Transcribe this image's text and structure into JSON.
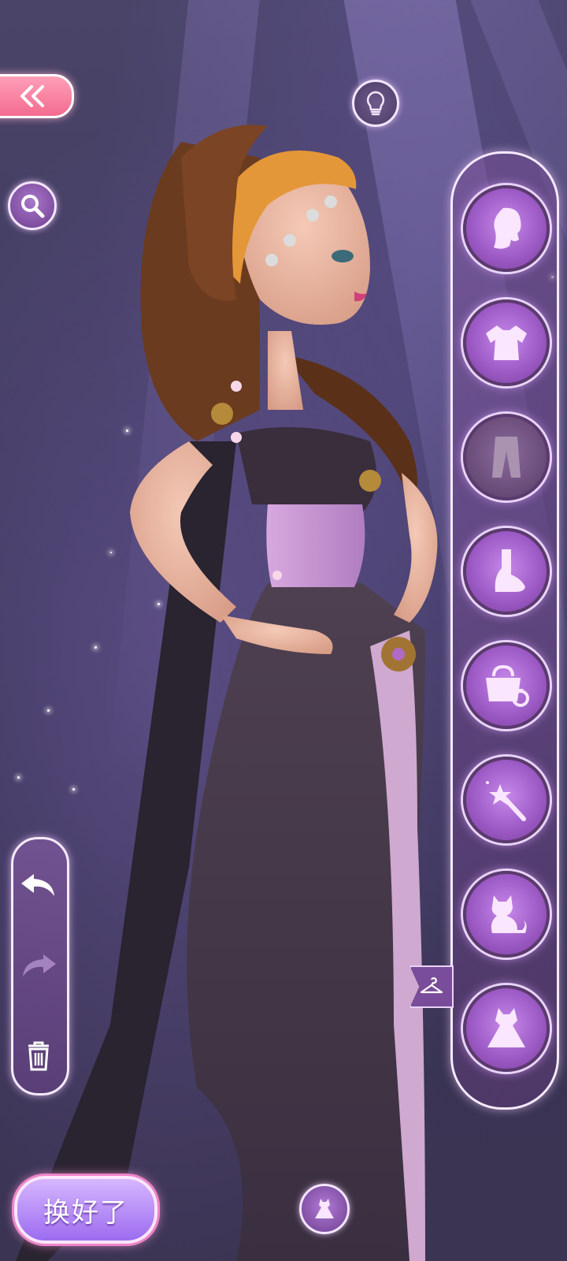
{
  "top_bar": {
    "back_icon": "double-chevron-left-icon",
    "hint_icon": "lightbulb-icon",
    "search_icon": "search-icon"
  },
  "categories": [
    {
      "name": "hair",
      "icon": "hair-silhouette-icon",
      "active": true
    },
    {
      "name": "top",
      "icon": "top-clothing-icon",
      "active": true
    },
    {
      "name": "bottom",
      "icon": "pants-icon",
      "active": false
    },
    {
      "name": "shoes",
      "icon": "foot-icon",
      "active": true
    },
    {
      "name": "accessories",
      "icon": "bag-ring-icon",
      "active": true
    },
    {
      "name": "effects",
      "icon": "magic-wand-icon",
      "active": true
    },
    {
      "name": "pet",
      "icon": "cat-icon",
      "active": true
    },
    {
      "name": "dress",
      "icon": "dress-icon",
      "active": true
    }
  ],
  "side_panel": {
    "undo_icon": "undo-arrow-icon",
    "redo_icon": "redo-arrow-icon",
    "delete_icon": "trash-icon"
  },
  "outfit_flag_icon": "hanger-icon",
  "confirm_button": {
    "label": "换好了"
  },
  "bottom_dress_icon": "dress-icon",
  "colors": {
    "accent": "#9e5cc7",
    "back_button": "#f36b8f",
    "background": "#3f3a5e"
  }
}
